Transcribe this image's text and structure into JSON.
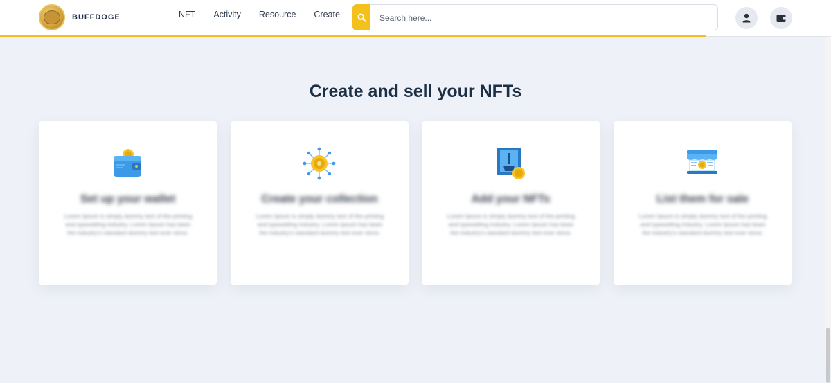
{
  "header": {
    "logo_text": "BUFFDOGE",
    "nav": [
      "NFT",
      "Activity",
      "Resource",
      "Create"
    ],
    "search": {
      "placeholder": "Search here..."
    },
    "icons": [
      "search-icon",
      "user-icon",
      "wallet-icon"
    ],
    "accent_color": "#f3c01c"
  },
  "section": {
    "title": "Create and sell your NFTs",
    "cards": [
      {
        "icon": "wallet-icon",
        "title": "Set up your wallet",
        "desc": "Lorem Ipsum is simply dummy text of the printing and typesetting industry. Lorem Ipsum has been the industry's standard dummy text ever since."
      },
      {
        "icon": "collection-icon",
        "title": "Create your collection",
        "desc": "Lorem Ipsum is simply dummy text of the printing and typesetting industry. Lorem Ipsum has been the industry's standard dummy text ever since."
      },
      {
        "icon": "add-nft-icon",
        "title": "Add your NFTs",
        "desc": "Lorem Ipsum is simply dummy text of the printing and typesetting industry. Lorem Ipsum has been the industry's standard dummy text ever since."
      },
      {
        "icon": "store-icon",
        "title": "List them for sale",
        "desc": "Lorem Ipsum is simply dummy text of the printing and typesetting industry. Lorem Ipsum has been the industry's standard dummy text ever since."
      }
    ]
  }
}
